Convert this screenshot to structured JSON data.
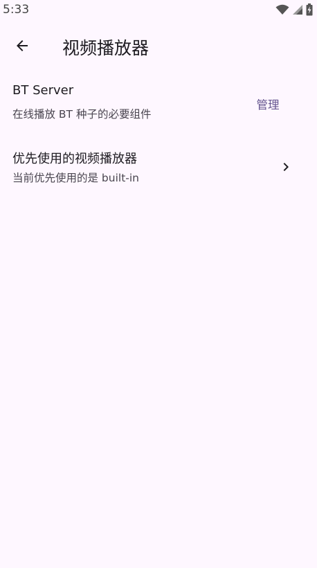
{
  "status_bar": {
    "time": "5:33",
    "icons": [
      "wifi-icon",
      "signal-icon",
      "battery-charging-icon"
    ]
  },
  "app_bar": {
    "title": "视频播放器",
    "back_icon": "arrow-left-icon"
  },
  "settings": {
    "bt_server": {
      "title": "BT Server",
      "subtitle": "在线播放 BT 种子的必要组件",
      "action_label": "管理"
    },
    "preferred_player": {
      "title": "优先使用的视频播放器",
      "subtitle": "当前优先使用的是 built-in",
      "trailing_icon": "chevron-right-icon"
    }
  },
  "colors": {
    "background": "#FEF7FF",
    "accent": "#65558F",
    "text_primary": "#1D1B20",
    "text_secondary": "#49454F"
  }
}
